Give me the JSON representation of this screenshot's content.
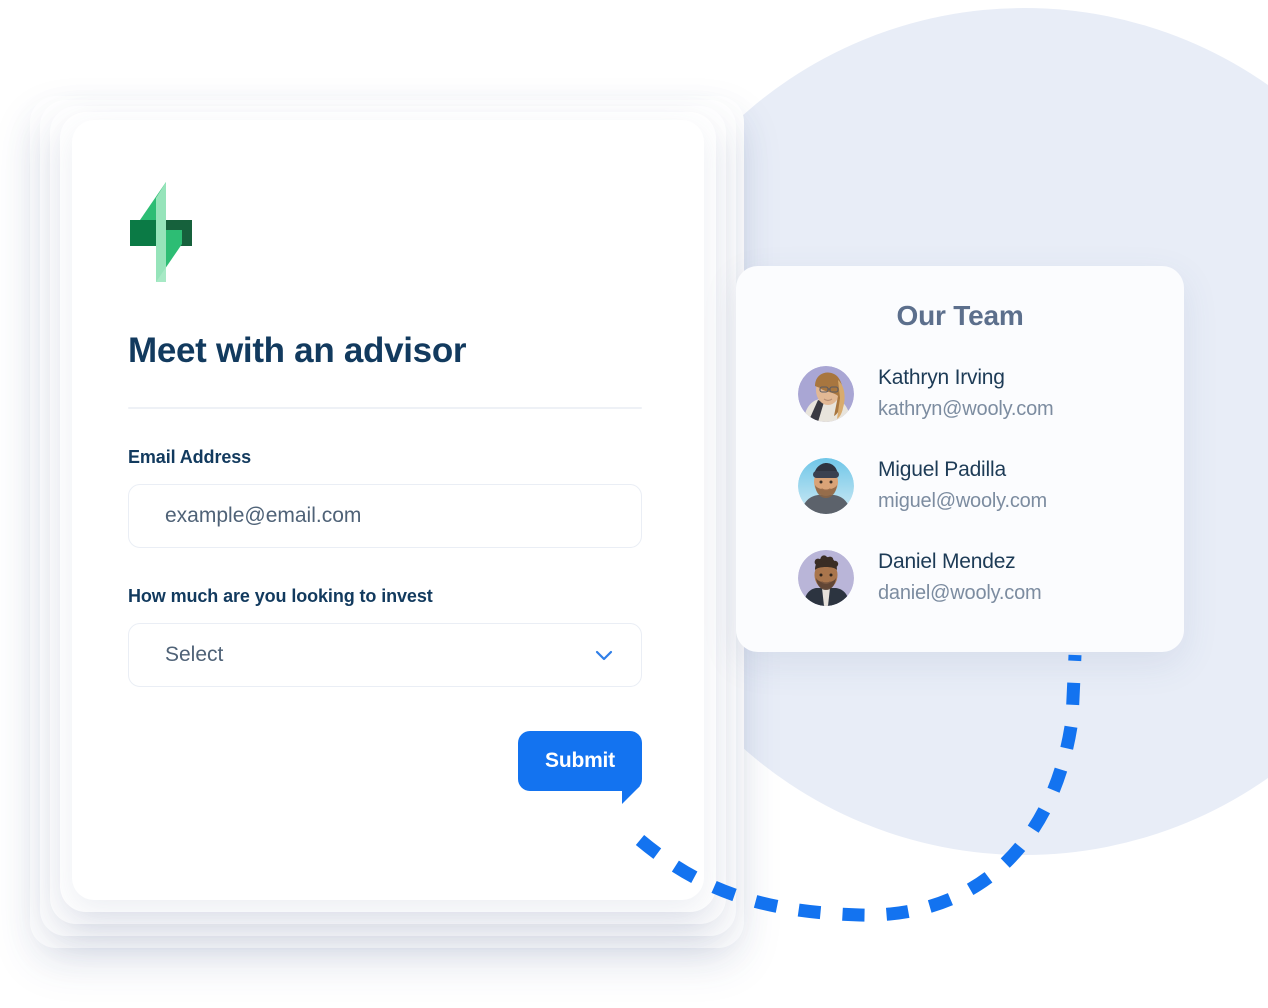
{
  "background": {
    "circle_color": "#e8edf7",
    "page_color": "#ffffff"
  },
  "connector": {
    "name": "dashed-connector-line",
    "color": "#1373f0",
    "style": "dashed"
  },
  "form_card": {
    "logo_name": "wooly-lightning-logo",
    "logo_colors": {
      "dark_green": "#0b7a45",
      "mid_green": "#2dbd74",
      "light_green": "#9fe7c0",
      "deep_green": "#16613c"
    },
    "title": "Meet with an advisor",
    "title_color": "#123a5e",
    "fields": [
      {
        "label": "Email Address",
        "name": "email-field",
        "type": "email",
        "value": "",
        "placeholder": "example@email.com"
      },
      {
        "label": "How much are you looking to invest",
        "name": "invest-amount-select",
        "type": "select",
        "value": "Select",
        "placeholder": "Select",
        "chevron_color": "#2f7fe8"
      }
    ],
    "submit_label": "Submit",
    "submit_color": "#1373f0"
  },
  "team_card": {
    "title": "Our Team",
    "title_color": "#5c6f8c",
    "members": [
      {
        "name": "Kathryn Irving",
        "email": "kathryn@wooly.com",
        "avatar_name": "avatar-kathryn-irving",
        "avatar_bg": "#a9a6d4"
      },
      {
        "name": "Miguel Padilla",
        "email": "miguel@wooly.com",
        "avatar_name": "avatar-miguel-padilla",
        "avatar_bg": "#9fd7ef"
      },
      {
        "name": "Daniel Mendez",
        "email": "daniel@wooly.com",
        "avatar_name": "avatar-daniel-mendez",
        "avatar_bg": "#b9b5d8"
      }
    ]
  }
}
